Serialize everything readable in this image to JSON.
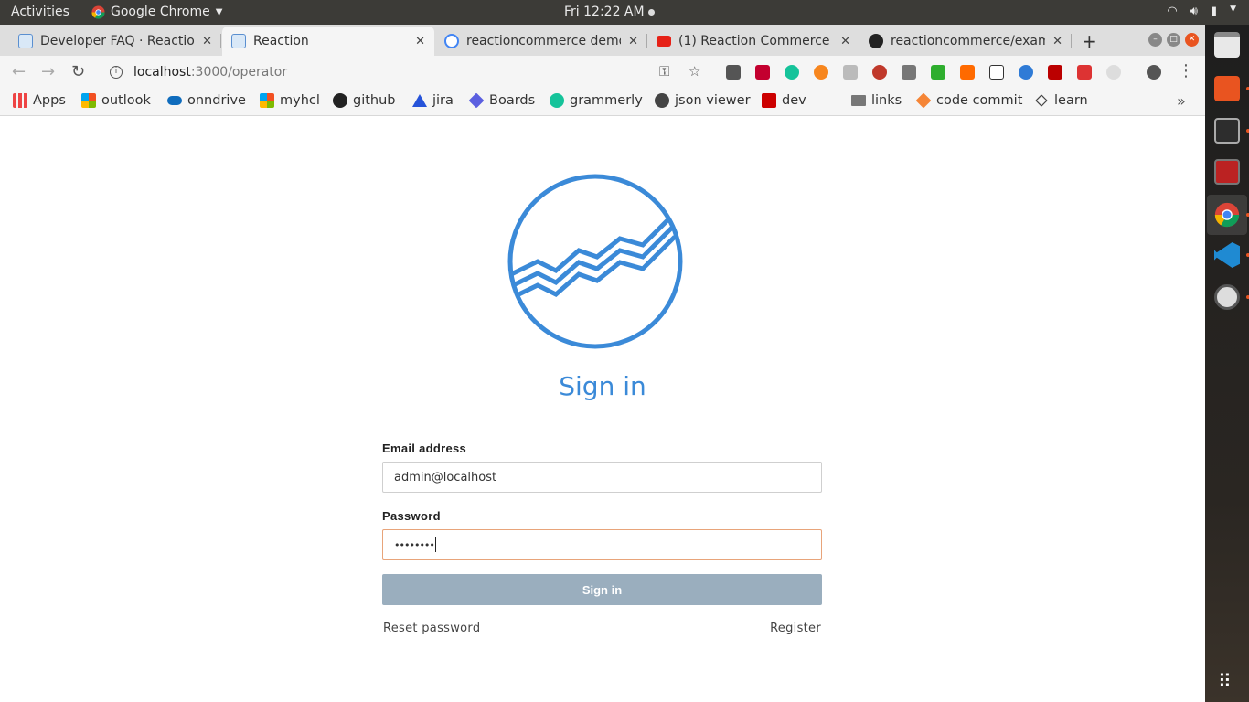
{
  "system": {
    "activities": "Activities",
    "app_menu": "Google Chrome",
    "clock": "Fri 12:22 AM"
  },
  "tabs": [
    {
      "title": "Developer FAQ · Reaction",
      "active": false
    },
    {
      "title": "Reaction",
      "active": true
    },
    {
      "title": "reactioncommerce demo",
      "active": false
    },
    {
      "title": "(1) Reaction Commerce -",
      "active": false
    },
    {
      "title": "reactioncommerce/exam",
      "active": false
    }
  ],
  "toolbar": {
    "url_host": "localhost",
    "url_path": ":3000/operator"
  },
  "bookmarks": [
    {
      "label": "Apps",
      "icon": "apps-grid-icon"
    },
    {
      "label": "outlook",
      "icon": "microsoft-icon"
    },
    {
      "label": "onndrive",
      "icon": "cloud-icon"
    },
    {
      "label": "myhcl",
      "icon": "microsoft-icon"
    },
    {
      "label": "github",
      "icon": "github-icon"
    },
    {
      "label": "jira",
      "icon": "jira-icon"
    },
    {
      "label": "Boards",
      "icon": "boards-icon"
    },
    {
      "label": "grammerly",
      "icon": "grammarly-icon"
    },
    {
      "label": "json viewer",
      "icon": "globe-icon"
    },
    {
      "label": "dev",
      "icon": "dev-icon"
    },
    {
      "label": "links",
      "icon": "folder-icon"
    },
    {
      "label": "code commit",
      "icon": "codecommit-icon"
    },
    {
      "label": "learn",
      "icon": "learn-icon"
    }
  ],
  "signin": {
    "title": "Sign in",
    "email_label": "Email address",
    "email_value": "admin@localhost",
    "password_label": "Password",
    "password_value": "••••••••",
    "button_label": "Sign in",
    "reset_link": "Reset password",
    "register_link": "Register"
  },
  "colors": {
    "accent": "#3b8ad8",
    "button": "#9aaebe",
    "focus_border": "#e8a47a"
  }
}
